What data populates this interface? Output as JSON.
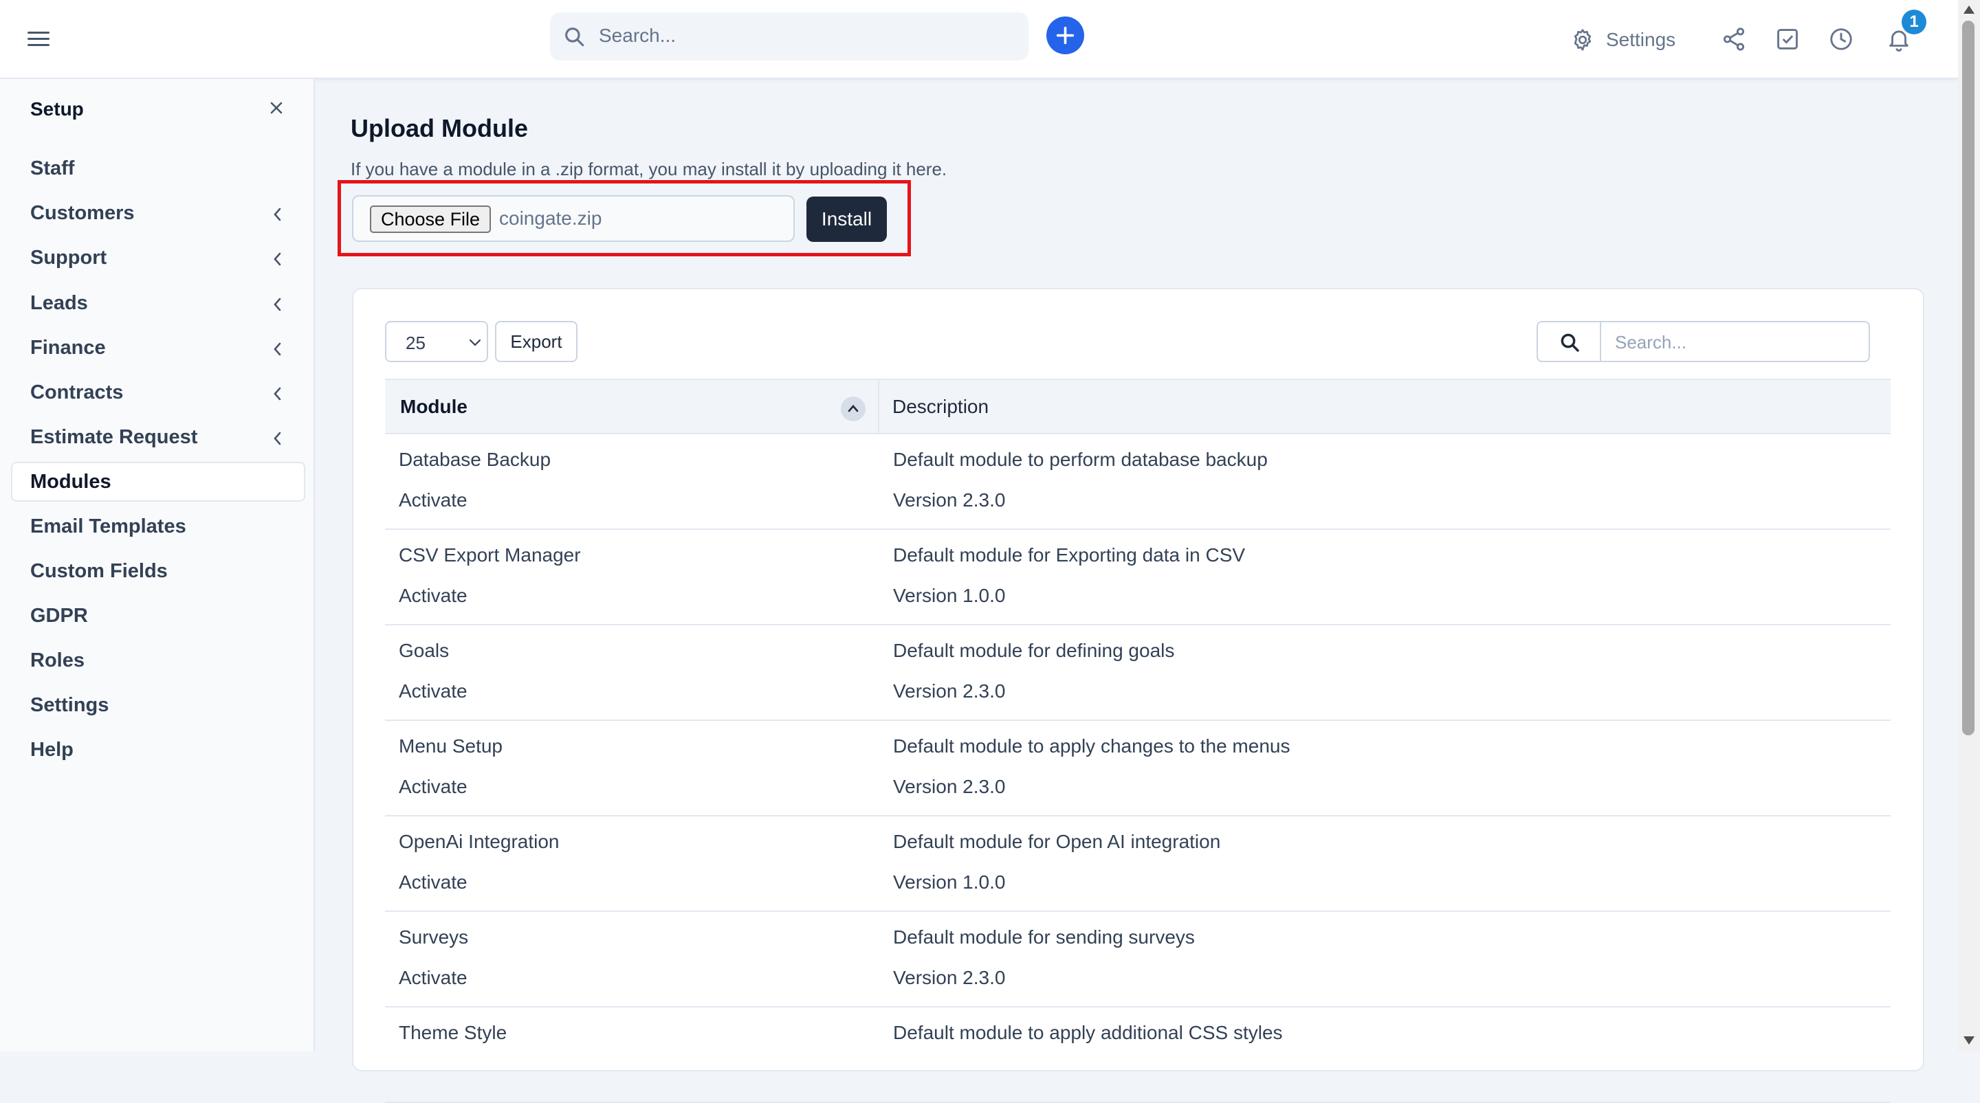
{
  "topbar": {
    "search_placeholder": "Search...",
    "settings_label": "Settings",
    "notification_count": "1",
    "icons": [
      "menu-icon",
      "search-icon",
      "plus-icon",
      "gear-icon",
      "share-icon",
      "checkbox-icon",
      "clock-icon",
      "bell-icon"
    ]
  },
  "sidebar": {
    "title": "Setup",
    "items": [
      {
        "label": "Staff",
        "has_submenu": false
      },
      {
        "label": "Customers",
        "has_submenu": true
      },
      {
        "label": "Support",
        "has_submenu": true
      },
      {
        "label": "Leads",
        "has_submenu": true
      },
      {
        "label": "Finance",
        "has_submenu": true
      },
      {
        "label": "Contracts",
        "has_submenu": true
      },
      {
        "label": "Estimate Request",
        "has_submenu": true
      },
      {
        "label": "Modules",
        "has_submenu": false,
        "active": true
      },
      {
        "label": "Email Templates",
        "has_submenu": false
      },
      {
        "label": "Custom Fields",
        "has_submenu": false
      },
      {
        "label": "GDPR",
        "has_submenu": false
      },
      {
        "label": "Roles",
        "has_submenu": false
      },
      {
        "label": "Settings",
        "has_submenu": false
      },
      {
        "label": "Help",
        "has_submenu": false
      }
    ]
  },
  "upload": {
    "title": "Upload Module",
    "description": "If you have a module in a .zip format, you may install it by uploading it here.",
    "choose_file_label": "Choose File",
    "file_name": "coingate.zip",
    "install_label": "Install"
  },
  "table": {
    "page_length": "25",
    "export_label": "Export",
    "search_placeholder": "Search...",
    "columns": [
      "Module",
      "Description"
    ],
    "rows": [
      {
        "name": "Database Backup",
        "action": "Activate",
        "description": "Default module to perform database backup",
        "version": "Version 2.3.0"
      },
      {
        "name": "CSV Export Manager",
        "action": "Activate",
        "description": "Default module for Exporting data in CSV",
        "version": "Version 1.0.0"
      },
      {
        "name": "Goals",
        "action": "Activate",
        "description": "Default module for defining goals",
        "version": "Version 2.3.0"
      },
      {
        "name": "Menu Setup",
        "action": "Activate",
        "description": "Default module to apply changes to the menus",
        "version": "Version 2.3.0"
      },
      {
        "name": "OpenAi Integration",
        "action": "Activate",
        "description": "Default module for Open AI integration",
        "version": "Version 1.0.0"
      },
      {
        "name": "Surveys",
        "action": "Activate",
        "description": "Default module for sending surveys",
        "version": "Version 2.3.0"
      },
      {
        "name": "Theme Style",
        "action": "",
        "description": "Default module to apply additional CSS styles",
        "version": ""
      }
    ]
  },
  "colors": {
    "accent": "#2563eb",
    "highlight_border": "#e5141a",
    "install_button": "#1e293b",
    "badge": "#1d8ad7"
  }
}
